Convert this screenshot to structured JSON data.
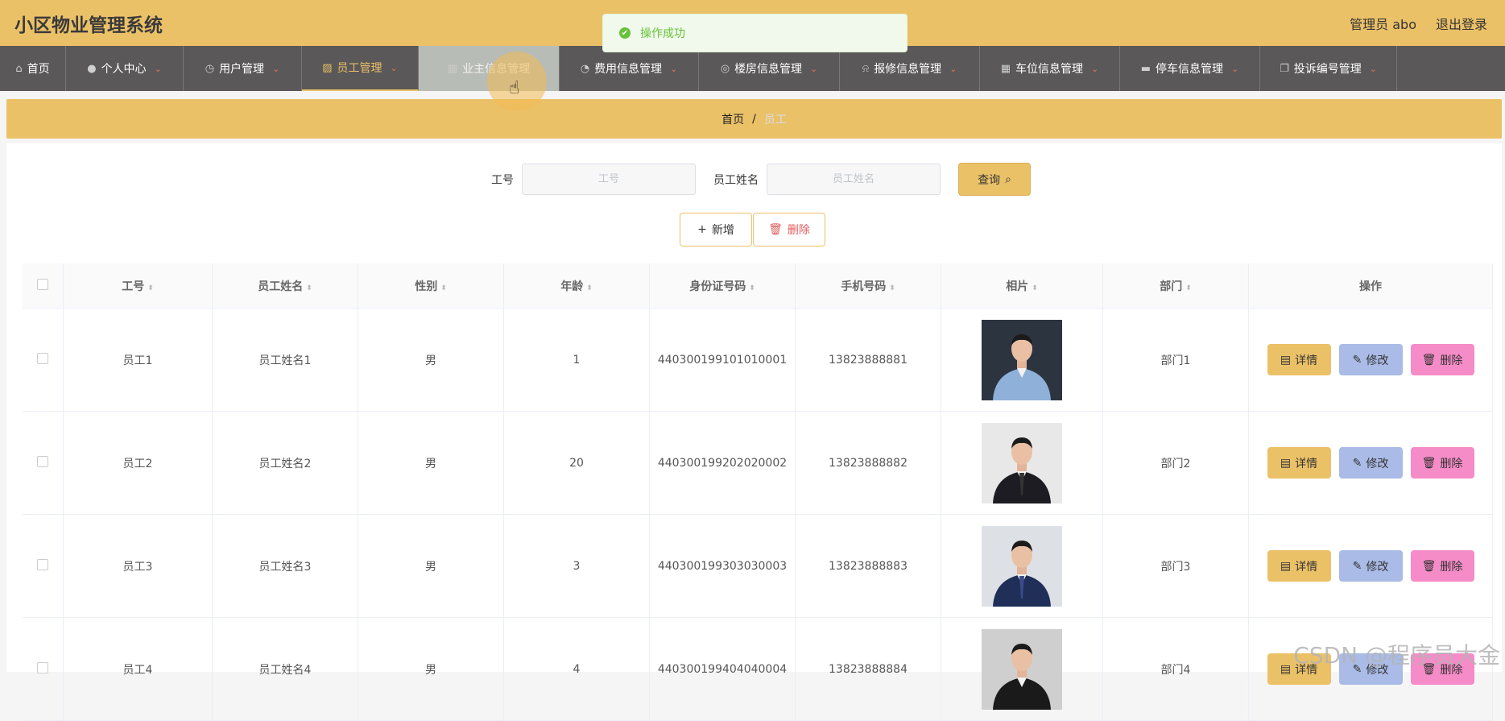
{
  "app": {
    "title": "小区物业管理系统",
    "user_label": "管理员 abo",
    "logout_label": "退出登录"
  },
  "toast": {
    "message": "操作成功"
  },
  "nav": [
    {
      "label": "首页",
      "icon": "home-icon",
      "has_caret": false
    },
    {
      "label": "个人中心",
      "icon": "user-icon",
      "has_caret": true
    },
    {
      "label": "用户管理",
      "icon": "clock-icon",
      "has_caret": true
    },
    {
      "label": "员工管理",
      "icon": "chart-icon",
      "has_caret": true,
      "active": true
    },
    {
      "label": "业主信息管理",
      "icon": "book-icon",
      "has_caret": false,
      "hover": true
    },
    {
      "label": "费用信息管理",
      "icon": "gauge-icon",
      "has_caret": true
    },
    {
      "label": "楼房信息管理",
      "icon": "compass-icon",
      "has_caret": true
    },
    {
      "label": "报修信息管理",
      "icon": "bell-off-icon",
      "has_caret": true
    },
    {
      "label": "车位信息管理",
      "icon": "grid-icon",
      "has_caret": true
    },
    {
      "label": "停车信息管理",
      "icon": "monitor-icon",
      "has_caret": true
    },
    {
      "label": "投诉编号管理",
      "icon": "copy-icon",
      "has_caret": true
    }
  ],
  "breadcrumb": {
    "home": "首页",
    "separator": "/",
    "current": "员工"
  },
  "search": {
    "id_label": "工号",
    "id_placeholder": "工号",
    "name_label": "员工姓名",
    "name_placeholder": "员工姓名",
    "query_label": "查询"
  },
  "actions": {
    "add_label": "新增",
    "delete_label": "删除"
  },
  "table": {
    "columns": [
      "工号",
      "员工姓名",
      "性别",
      "年龄",
      "身份证号码",
      "手机号码",
      "相片",
      "部门",
      "操作"
    ],
    "rows": [
      {
        "id": "员工1",
        "name": "员工姓名1",
        "gender": "男",
        "age": "1",
        "idcard": "440300199101010001",
        "phone": "13823888881",
        "dept": "部门1",
        "photo": "man-blue-shirt"
      },
      {
        "id": "员工2",
        "name": "员工姓名2",
        "gender": "男",
        "age": "20",
        "idcard": "440300199202020002",
        "phone": "13823888882",
        "dept": "部门2",
        "photo": "man-black-suit"
      },
      {
        "id": "员工3",
        "name": "员工姓名3",
        "gender": "男",
        "age": "3",
        "idcard": "440300199303030003",
        "phone": "13823888883",
        "dept": "部门3",
        "photo": "man-navy-suit"
      },
      {
        "id": "员工4",
        "name": "员工姓名4",
        "gender": "男",
        "age": "4",
        "idcard": "440300199404040004",
        "phone": "13823888884",
        "dept": "部门4",
        "photo": "woman-black-suit"
      }
    ],
    "op_detail": "详情",
    "op_edit": "修改",
    "op_delete": "删除"
  },
  "watermark": "CSDN @程序员大金",
  "colors": {
    "header": "#ebc168",
    "nav": "#5a5858",
    "accent": "#ebc168",
    "edit": "#a9bbe6",
    "delete": "#f58bc7"
  }
}
